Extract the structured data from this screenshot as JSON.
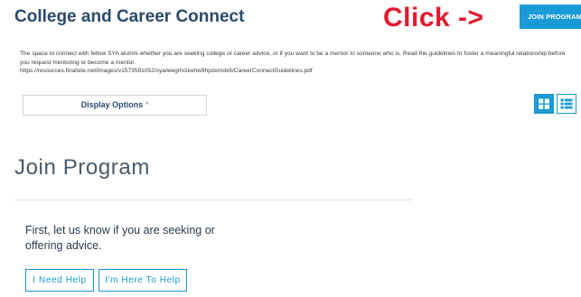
{
  "header": {
    "title": "College and Career Connect",
    "annotation": "Click ->",
    "join_button_label": "JOIN PROGRAM"
  },
  "description": {
    "text": "The space to connect with fellow SYA alumni whether you are seeking college or career advice, or if you want to be a mentor to someone who is. Read the guidelines to foster a meaningful relationship before you request mentoring or become a mentor.",
    "link": "https://resources.finalsite.net/images/v1573591052/sya/wegrhcikohw9hpzemdx6/CareerConnectGuidelines.pdf"
  },
  "display_options": {
    "label": "Display Options",
    "caret": "^"
  },
  "view_toggle": {
    "active": "grid",
    "accent": "#1a9ad6"
  },
  "join_section": {
    "title": "Join Program",
    "prompt": "First, let us know if you are seeking or offering advice.",
    "need_help_label": "I Need Help",
    "offer_help_label": "I'm Here To Help"
  },
  "colors": {
    "brand_blue": "#1a9ad6",
    "title_navy": "#2b4a6b",
    "annotation_red": "#e3182d"
  }
}
